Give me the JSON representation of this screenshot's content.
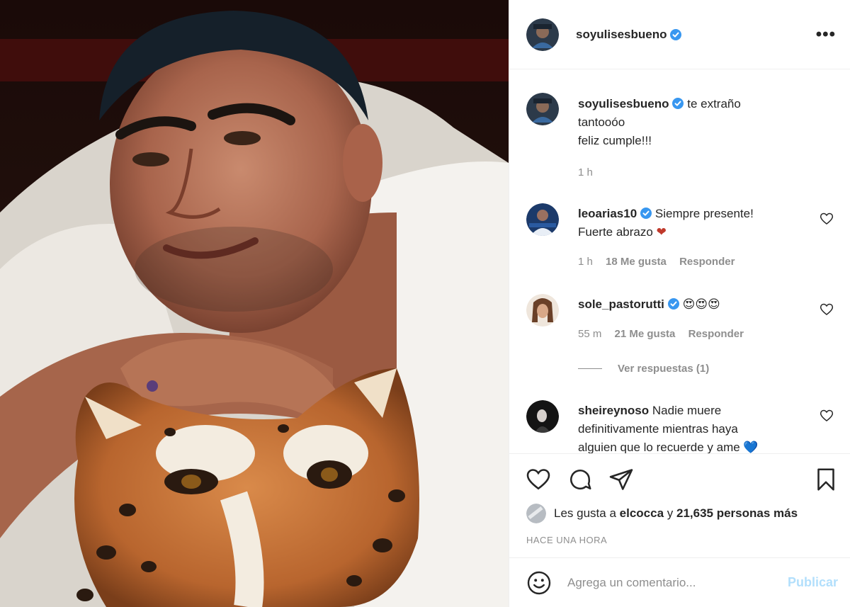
{
  "post": {
    "photo_alt": "",
    "author": {
      "username": "soyulisesbueno",
      "verified": true
    },
    "more_icon": "more-options-icon",
    "caption": {
      "username": "soyulisesbueno",
      "text_line1": "te extraño",
      "text_line2": "tantooóo",
      "text_line3": "feliz cumple!!!",
      "time": "1 h"
    },
    "comments": [
      {
        "username": "leoarias10",
        "verified": true,
        "text_line1": "Siempre presente!",
        "text_line2": "Fuerte abrazo",
        "emoji": "❤",
        "time": "1 h",
        "likes": "18 Me gusta",
        "reply": "Responder"
      },
      {
        "username": "sole_pastorutti",
        "verified": true,
        "text_line1": "😍😍😍",
        "time": "55 m",
        "likes": "21 Me gusta",
        "reply": "Responder",
        "view_replies": "Ver respuestas (1)"
      },
      {
        "username": "sheireynoso",
        "verified": false,
        "text_line1": "Nadie muere",
        "text_line2": "definitivamente mientras haya",
        "text_line3": "alguien que lo recuerde y ame 💙"
      }
    ],
    "actions": {
      "like_icon": "heart-icon",
      "comment_icon": "comment-icon",
      "share_icon": "paper-plane-icon",
      "save_icon": "bookmark-icon"
    },
    "likes": {
      "prefix": "Les gusta a",
      "user": "elcocca",
      "connector": "y",
      "count": "21,635 personas más"
    },
    "timestamp": "HACE UNA HORA",
    "add_comment": {
      "placeholder": "Agrega un comentario...",
      "publish_label": "Publicar",
      "emoji_icon": "smiley-icon"
    }
  },
  "colors": {
    "verified": "#3897f0",
    "publish_disabled": "#b2dffc",
    "muted": "#8e8e8e",
    "text": "#262626",
    "border": "#efefef"
  }
}
